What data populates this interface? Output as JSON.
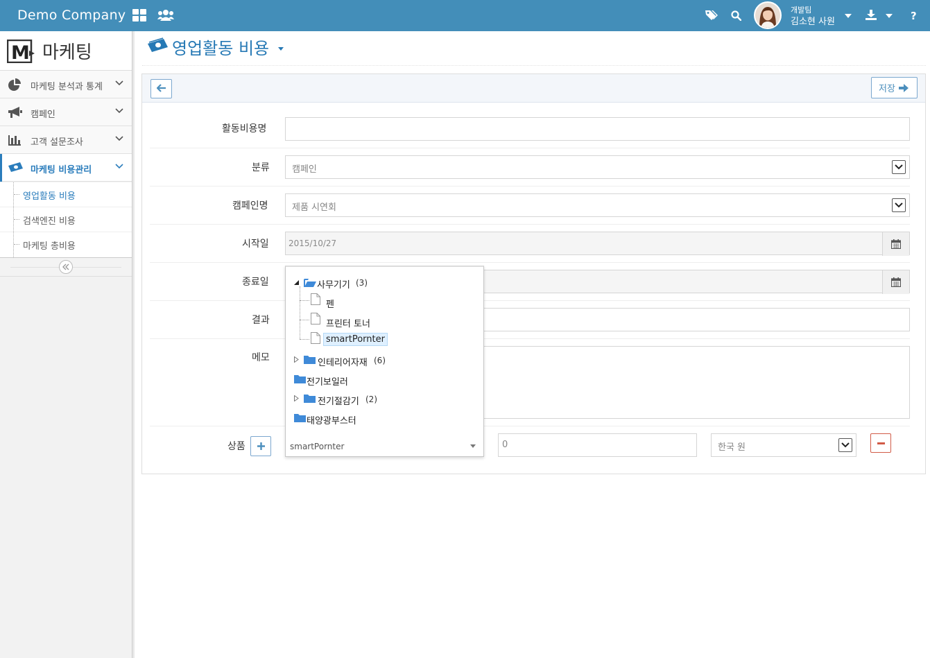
{
  "topbar": {
    "brand": "Demo Company",
    "user_team": "개발팀",
    "user_name": "김소현 사원"
  },
  "sidebar": {
    "logo_text": "마케팅",
    "items": [
      {
        "label": "마케팅 분석과 통계",
        "icon": "pie-chart-icon"
      },
      {
        "label": "캠페인",
        "icon": "bullhorn-icon"
      },
      {
        "label": "고객 설문조사",
        "icon": "bar-chart-icon"
      },
      {
        "label": "마케팅 비용관리",
        "icon": "money-icon",
        "active": true
      }
    ],
    "sub_items": [
      {
        "label": "영업활동 비용",
        "active": true
      },
      {
        "label": "검색엔진 비용"
      },
      {
        "label": "마케팅 총비용"
      }
    ]
  },
  "page": {
    "title": "영업활동 비용"
  },
  "toolbar": {
    "save_label": "저장"
  },
  "form": {
    "name_label": "활동비용명",
    "name_value": "",
    "category_label": "분류",
    "category_value": "캠페인",
    "campaign_label": "캠페인명",
    "campaign_value": "제품 시연회",
    "start_label": "시작일",
    "start_value": "2015/10/27",
    "end_label": "종료일",
    "end_value": "",
    "result_label": "결과",
    "memo_label": "메모",
    "product_label": "상품",
    "product_value": "smartPornter",
    "amount_value": "0",
    "currency_value": "한국 원"
  },
  "tree": {
    "nodes": [
      {
        "label": "사무기기",
        "count": "(3)",
        "expanded": true
      },
      {
        "label": "펜"
      },
      {
        "label": "프린터 토너"
      },
      {
        "label": "smartPornter",
        "selected": true
      },
      {
        "label": "인테리어자재",
        "count": "(6)"
      },
      {
        "label": "전기보일러"
      },
      {
        "label": "전기절감기",
        "count": "(2)"
      },
      {
        "label": "태양광부스터"
      }
    ]
  },
  "colors": {
    "topbar": "#438eb9",
    "accent": "#2b7dbc",
    "danger": "#d15b47"
  }
}
